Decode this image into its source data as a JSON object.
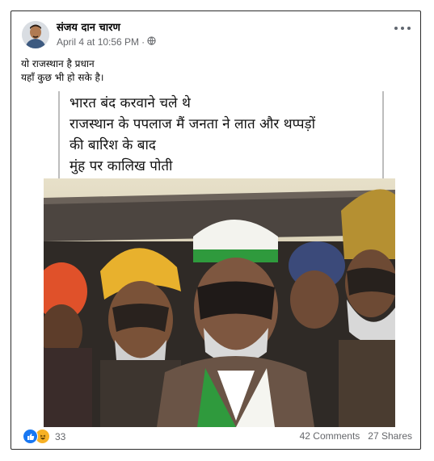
{
  "post": {
    "author": "संजय दान चारण",
    "timestamp": "April 4 at 10:56 PM",
    "separator": "·",
    "privacy_icon": "globe-icon",
    "more_icon": "more-options-icon",
    "caption_lines": [
      "यो राजस्थान है प्रधान",
      "यहाँ कुछ भी हो सके है।"
    ]
  },
  "meme": {
    "lines": [
      "भारत बंद करवाने चले थे",
      "राजस्थान के पपलाज मैं जनता ने लात और थप्पड़ों",
      "की बारिश के बाद",
      "मुंह पर कालिख पोती"
    ],
    "photo_icon": "photo-of-men-with-blackened-faces"
  },
  "footer": {
    "reactions": [
      "like-icon",
      "haha-icon"
    ],
    "reaction_count": "33",
    "comments": "42 Comments",
    "shares": "27 Shares"
  },
  "colors": {
    "link_blue": "#1877f2",
    "meta_gray": "#65676b",
    "haha_yellow": "#f7b125"
  }
}
